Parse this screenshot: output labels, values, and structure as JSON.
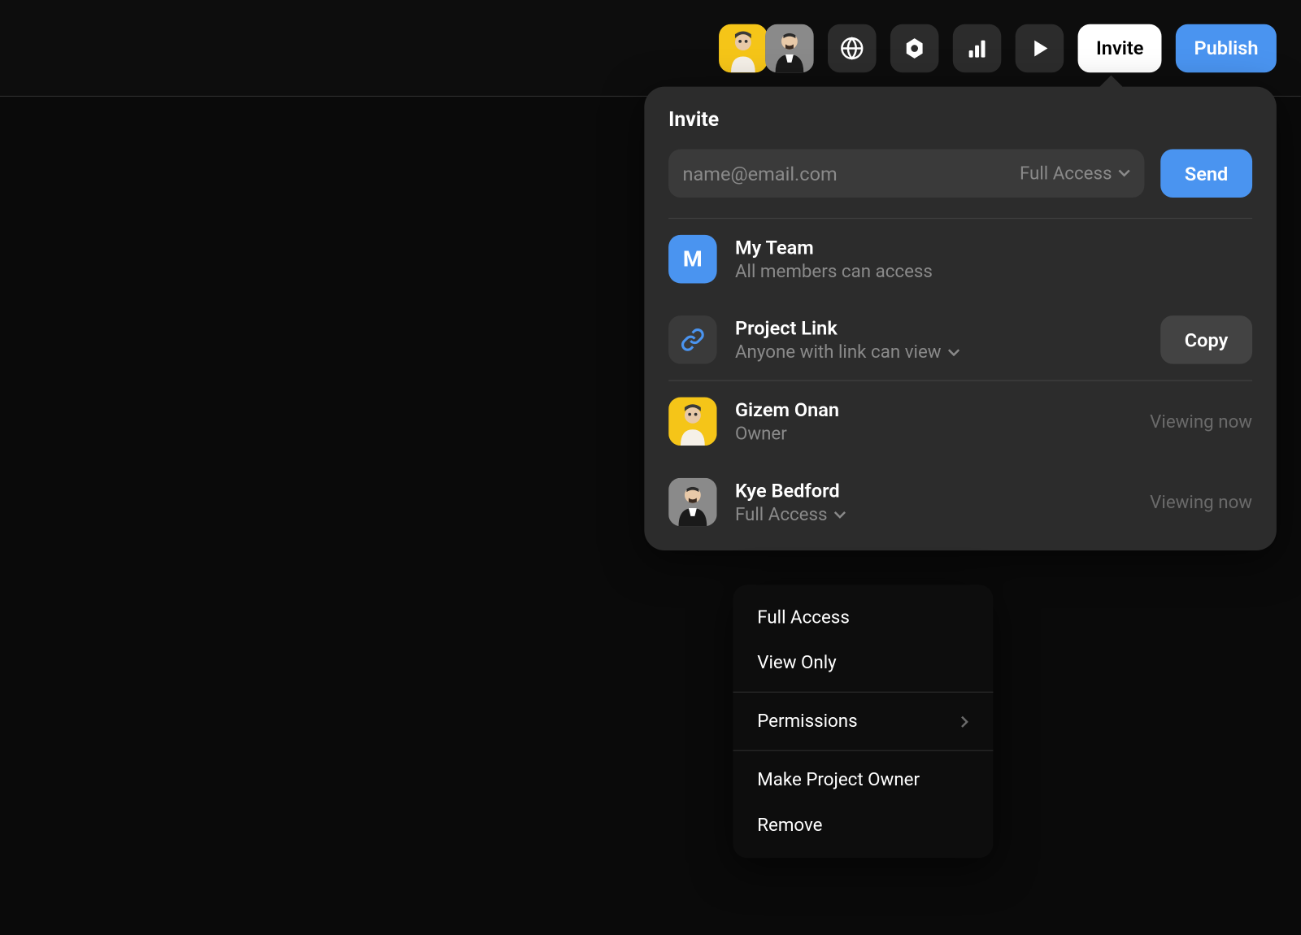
{
  "header": {
    "invite_label": "Invite",
    "publish_label": "Publish"
  },
  "popover": {
    "title": "Invite",
    "email_placeholder": "name@email.com",
    "access_label": "Full Access",
    "send_label": "Send",
    "team": {
      "badge": "M",
      "name": "My Team",
      "sub": "All members can access"
    },
    "link": {
      "name": "Project Link",
      "sub": "Anyone with link can view",
      "copy_label": "Copy"
    },
    "users": [
      {
        "name": "Gizem Onan",
        "role": "Owner",
        "status": "Viewing now",
        "avatar_color": "yellow"
      },
      {
        "name": "Kye Bedford",
        "role": "Full Access",
        "status": "Viewing now",
        "avatar_color": "gray"
      }
    ]
  },
  "context_menu": {
    "full_access": "Full Access",
    "view_only": "View Only",
    "permissions": "Permissions",
    "make_owner": "Make Project Owner",
    "remove": "Remove"
  }
}
